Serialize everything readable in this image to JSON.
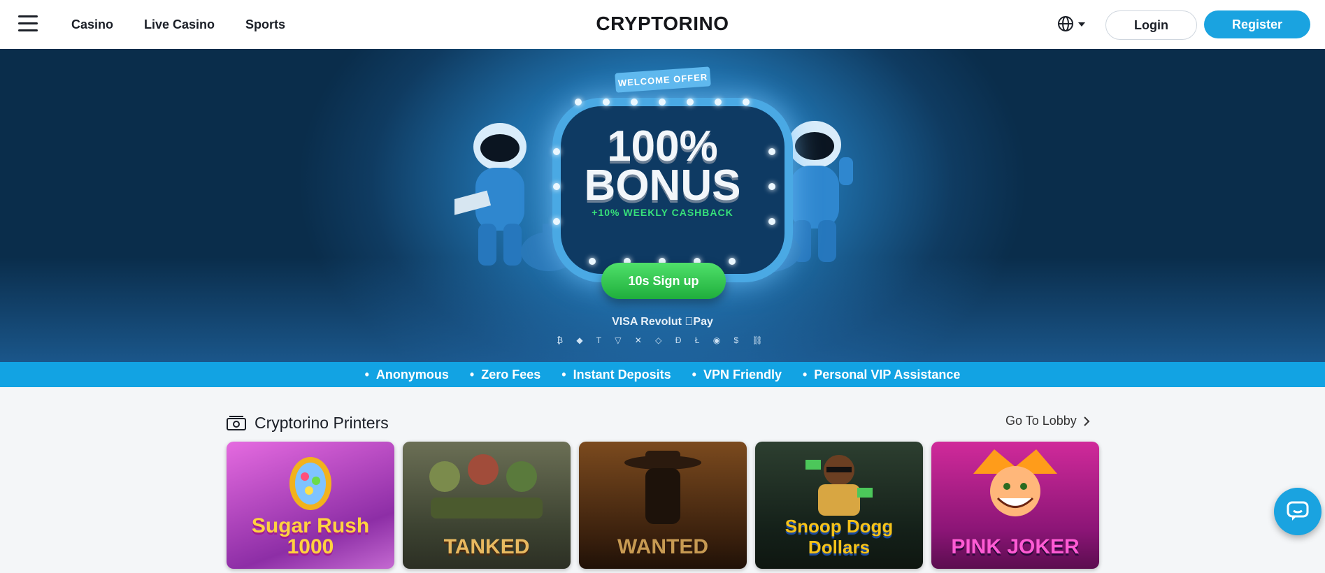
{
  "header": {
    "nav": [
      "Casino",
      "Live Casino",
      "Sports"
    ],
    "logo": "CRYPTORINO",
    "login": "Login",
    "register": "Register"
  },
  "hero": {
    "badge": "WELCOME OFFER",
    "line1": "100%",
    "line2": "BONUS",
    "cashback": "+10% WEEKLY CASHBACK",
    "signup": "10s Sign up",
    "payments": "VISA  Revolut  Pay",
    "cryptos": "₿ ◆ T ▽ ✕ ◇ Đ Ł ◉ $ ⛓"
  },
  "features": [
    "Anonymous",
    "Zero Fees",
    "Instant Deposits",
    "VPN Friendly",
    "Personal VIP Assistance"
  ],
  "section": {
    "title": "Cryptorino Printers",
    "lobby": "Go To Lobby"
  },
  "games": [
    {
      "title": "Sugar Rush 1000",
      "bg": "#c64ec7",
      "fg": "#ffd23f"
    },
    {
      "title": "TANKED",
      "bg": "#4d5a3c",
      "fg": "#e8b960"
    },
    {
      "title": "WANTED",
      "bg": "#5b3518",
      "fg": "#c79a52"
    },
    {
      "title": "Snoop Dogg Dollars",
      "bg": "#1b2a20",
      "fg": "#f5c21a"
    },
    {
      "title": "PINK JOKER",
      "bg": "#b2228a",
      "fg": "#ff5bd4"
    }
  ],
  "colors": {
    "accent": "#1aa3e0",
    "signup": "#22b33f"
  }
}
